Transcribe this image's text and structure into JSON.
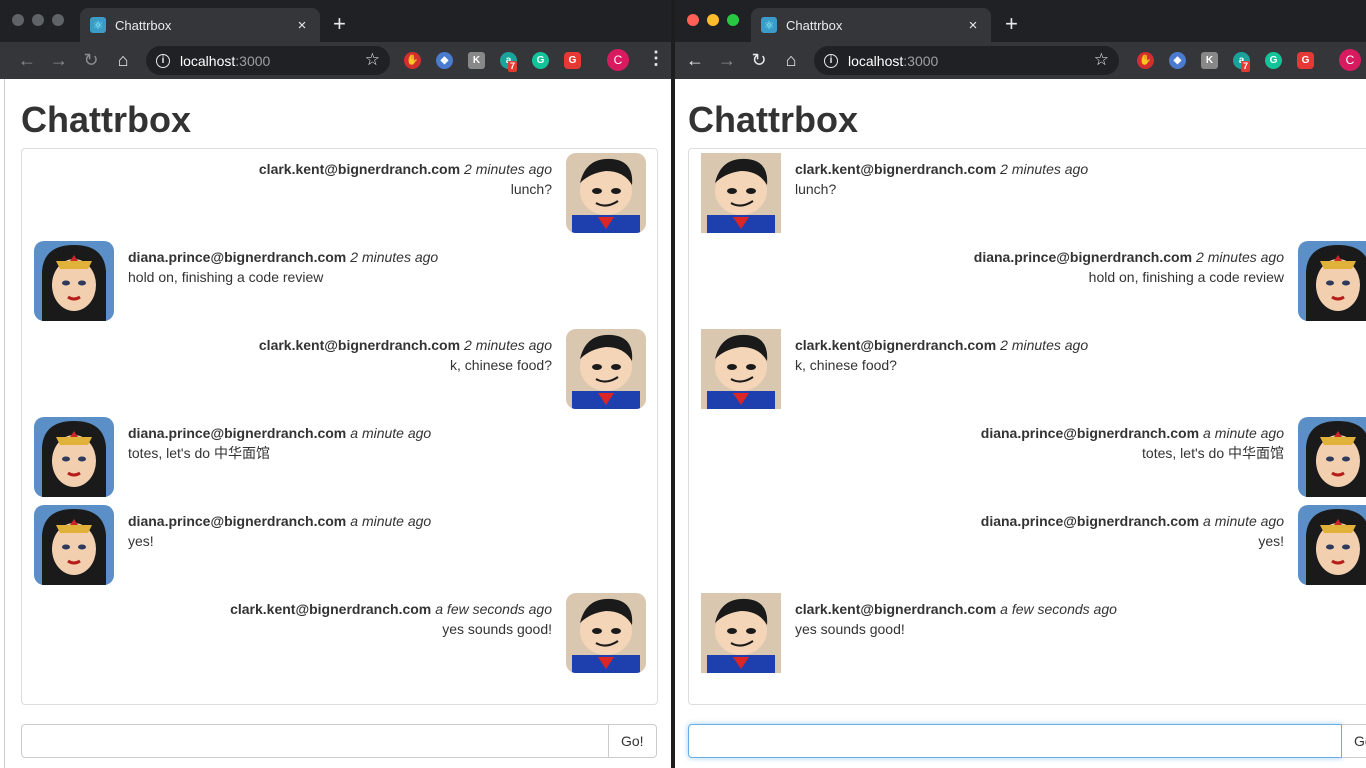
{
  "browser": {
    "tab_title": "Chattrbox",
    "tab_close": "×",
    "new_tab": "+",
    "url_host": "localhost",
    "url_port": ":3000",
    "profile_initial": "C",
    "extension_badge": "7",
    "icons": [
      "back-icon",
      "forward-icon",
      "reload-icon",
      "home-icon",
      "info-icon",
      "star-icon",
      "menu-icon"
    ]
  },
  "app": {
    "title": "Chattrbox",
    "go_label": "Go!",
    "input_value": ""
  },
  "messages": [
    {
      "author": "clark.kent@bignerdranch.com",
      "time": "2 minutes ago",
      "text": "lunch?"
    },
    {
      "author": "diana.prince@bignerdranch.com",
      "time": "2 minutes ago",
      "text": "hold on, finishing a code review"
    },
    {
      "author": "clark.kent@bignerdranch.com",
      "time": "2 minutes ago",
      "text": "k, chinese food?"
    },
    {
      "author": "diana.prince@bignerdranch.com",
      "time": "a minute ago",
      "text": "totes, let's do 中华面馆"
    },
    {
      "author": "diana.prince@bignerdranch.com",
      "time": "a minute ago",
      "text": "yes!"
    },
    {
      "author": "clark.kent@bignerdranch.com",
      "time": "a few seconds ago",
      "text": "yes sounds good!"
    }
  ],
  "colors": {
    "link_focus": "#66afe9",
    "tab_bg": "#35363a",
    "chrome_bg": "#202124"
  }
}
